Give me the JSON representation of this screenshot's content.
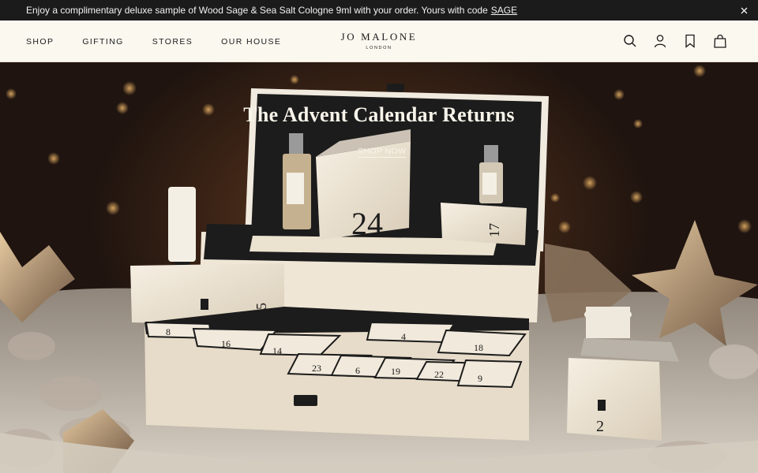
{
  "promo": {
    "text": "Enjoy a complimentary deluxe sample of Wood Sage & Sea Salt Cologne 9ml with your order. Yours with code",
    "code": "SAGE",
    "close_icon": "close-icon"
  },
  "nav": {
    "items": [
      {
        "label": "SHOP"
      },
      {
        "label": "GIFTING"
      },
      {
        "label": "STORES"
      },
      {
        "label": "OUR HOUSE"
      }
    ]
  },
  "logo": {
    "brand": "JO MALONE",
    "sub": "LONDON"
  },
  "header_icons": [
    "search-icon",
    "account-icon",
    "wishlist-icon",
    "bag-icon"
  ],
  "hero": {
    "title": "The Advent Calendar Returns",
    "cta": "SHOP NOW",
    "box_numbers": {
      "front_cube": "24",
      "left_drawer": "5",
      "small_cube": "17",
      "right_cube": "2",
      "tile_row1": [
        "8",
        "16",
        "14",
        "4",
        "18"
      ],
      "tile_row2": [
        "23",
        "6",
        "19",
        "22",
        "9"
      ]
    }
  },
  "colors": {
    "banner_bg": "#1b1b1b",
    "header_bg": "#fbf8ef",
    "box_cream": "#efe6d6",
    "box_dark": "#1c1c1c"
  }
}
